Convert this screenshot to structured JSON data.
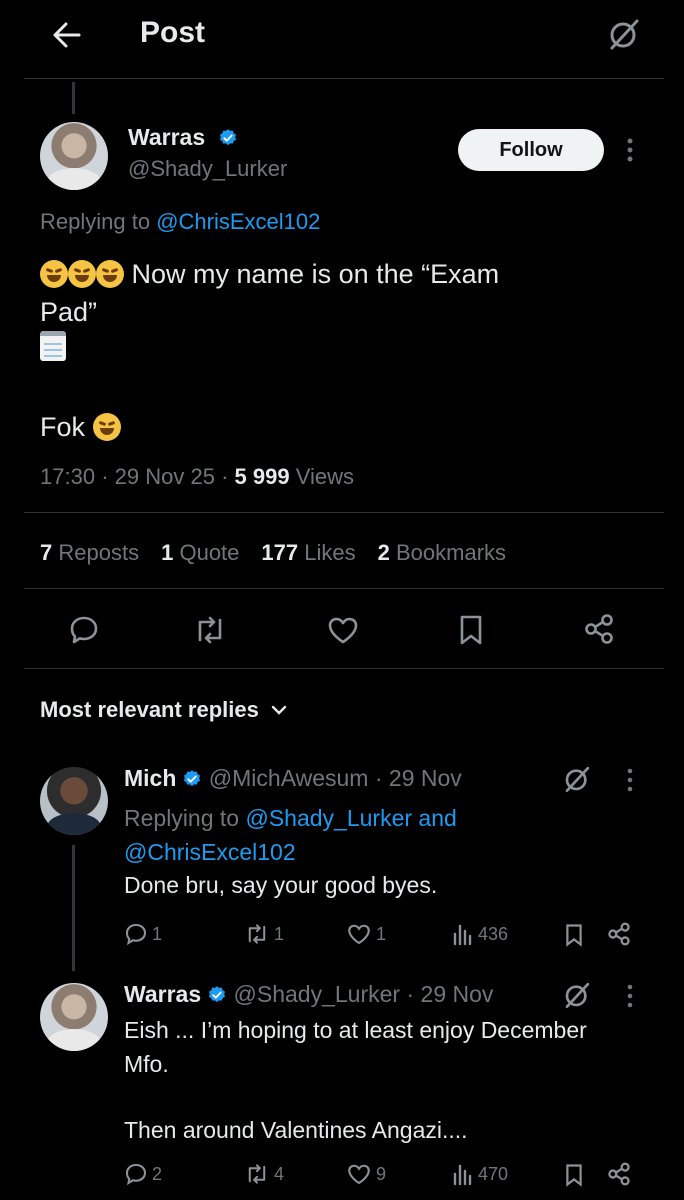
{
  "header": {
    "title": "Post"
  },
  "main_post": {
    "author_name": "Warras",
    "author_handle": "@Shady_Lurker",
    "follow_label": "Follow",
    "replying_prefix": "Replying to",
    "replying_to": "@ChrisExcel102",
    "text_line1": "Now my name is on the “Exam",
    "text_line2": "Pad”",
    "text_line3": "Fok",
    "time": "17:30",
    "date": "29 Nov 25",
    "views_count": "5 999",
    "views_label": "Views",
    "sep": "·"
  },
  "stats": {
    "reposts_count": "7",
    "reposts_label": "Reposts",
    "quotes_count": "1",
    "quotes_label": "Quote",
    "likes_count": "177",
    "likes_label": "Likes",
    "bookmarks_count": "2",
    "bookmarks_label": "Bookmarks"
  },
  "replies_header": "Most relevant replies",
  "replies": [
    {
      "name": "Mich",
      "handle": "@MichAwesum",
      "date": "· 29 Nov",
      "replying_prefix": "Replying to",
      "replying_to_1": "@Shady_Lurker",
      "replying_and": "and",
      "replying_to_2": "@ChrisExcel102",
      "text": "Done bru, say your good byes.",
      "replies_count": "1",
      "reposts_count": "1",
      "likes_count": "1",
      "views_count": "436"
    },
    {
      "name": "Warras",
      "handle": "@Shady_Lurker",
      "date": "· 29 Nov",
      "text_line1": "Eish ... I’m hoping to at least enjoy December",
      "text_line2": "Mfo.",
      "text_line3": "Then around Valentines Angazi....",
      "replies_count": "2",
      "reposts_count": "4",
      "likes_count": "9",
      "views_count": "470"
    }
  ],
  "colors": {
    "background": "#000000",
    "accent": "#1d9bf0",
    "text": "#e7e9ea",
    "muted": "#71767b",
    "divider": "#2f3336"
  }
}
